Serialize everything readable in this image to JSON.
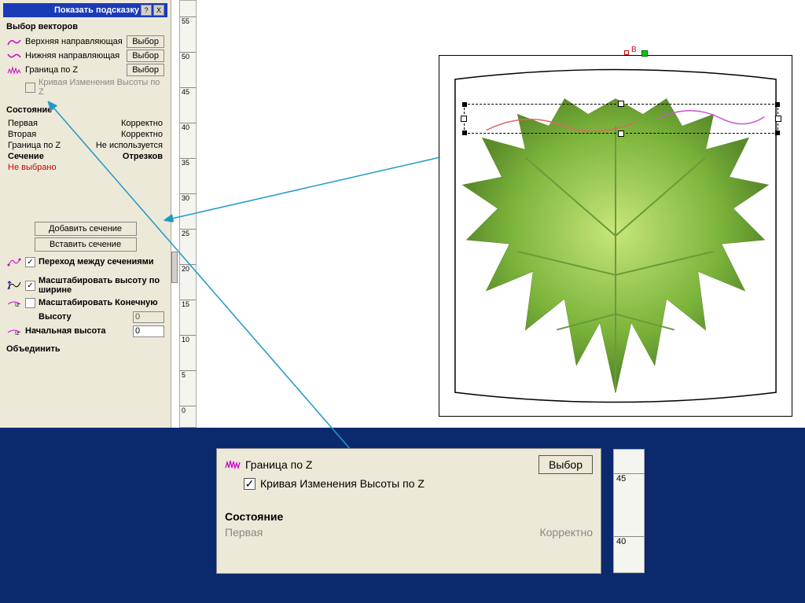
{
  "hint_bar": {
    "label": "Показать подсказку",
    "help": "?",
    "close": "X"
  },
  "vectors": {
    "title": "Выбор векторов",
    "row1": {
      "icon": "curve-top-icon",
      "label": "Верхняя направляющая",
      "btn": "Выбор"
    },
    "row2": {
      "icon": "curve-bottom-icon",
      "label": "Нижняя направляющая",
      "btn": "Выбор"
    },
    "row3": {
      "icon": "z-boundary-icon",
      "label": "Граница по Z",
      "btn": "Выбор"
    },
    "row4": {
      "label": "Кривая Изменения Высоты по Z"
    }
  },
  "state": {
    "title": "Состояние",
    "r1": {
      "k": "Первая",
      "v": "Корректно"
    },
    "r2": {
      "k": "Вторая",
      "v": "Корректно"
    },
    "r3": {
      "k": "Граница по Z",
      "v": "Не используется"
    },
    "r4": {
      "k": "Сечение",
      "v": "Отрезков"
    },
    "r5": {
      "k": "Не выбрано"
    }
  },
  "sections": {
    "add": "Добавить сечение",
    "insert": "Вставить сечение",
    "transition": "Переход между сечениями"
  },
  "scale": {
    "byWidth": "Масштабировать высоту по ширине",
    "final": "Масштабировать Конечную",
    "height": "Высоту",
    "heightVal": "0",
    "startHeight": "Начальная высота",
    "startVal": "0"
  },
  "combine": "Объединить",
  "ruler_ticks": [
    "55",
    "50",
    "45",
    "40",
    "35",
    "30",
    "25",
    "20",
    "15",
    "10",
    "5",
    "0"
  ],
  "canvas_marker": "B",
  "zoom": {
    "row3": {
      "label": "Граница по Z",
      "btn": "Выбор"
    },
    "row4": {
      "check": "✓",
      "label": "Кривая Изменения Высоты по Z"
    },
    "state_title": "Состояние",
    "state_r1": {
      "k": "Первая",
      "v": "Корректно"
    },
    "ruler": [
      "45",
      "40"
    ]
  }
}
